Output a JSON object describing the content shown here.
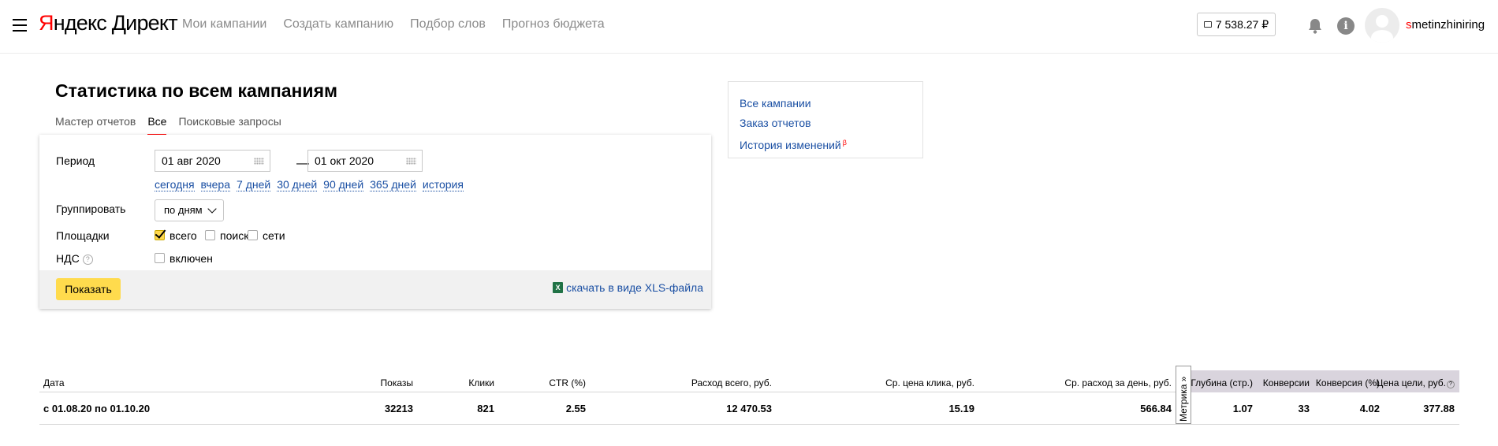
{
  "header": {
    "logo_ya": "Я",
    "logo_rest": "ндекс Директ",
    "nav": [
      "Мои кампании",
      "Создать кампанию",
      "Подбор слов",
      "Прогноз бюджета"
    ],
    "balance": "7 538.27 ₽",
    "username_first": "s",
    "username_rest": "metinzhiniring"
  },
  "page": {
    "title": "Статистика по всем кампаниям",
    "tabs": [
      "Мастер отчетов",
      "Все",
      "Поисковые запросы"
    ]
  },
  "form": {
    "period_label": "Период",
    "date_from": "01 авг 2020",
    "date_to": "01 окт 2020",
    "dash": "—",
    "quick_links": [
      "сегодня",
      "вчера",
      "7 дней",
      "30 дней",
      "90 дней",
      "365 дней",
      "история"
    ],
    "group_label": "Группировать",
    "group_value": "по дням",
    "platforms_label": "Площадки",
    "platforms": [
      "всего",
      "поиск",
      "сети"
    ],
    "vat_label": "НДС",
    "vat_help": "?",
    "vat_option": "включен",
    "show_button": "Показать",
    "xls_link": "скачать в виде XLS-файла",
    "xls_icon": "X"
  },
  "side_links": {
    "all_campaigns": "Все кампании",
    "order_reports": "Заказ отчетов",
    "history": "История изменений",
    "beta": "β"
  },
  "table": {
    "headers": [
      "Дата",
      "Показы",
      "Клики",
      "CTR (%)",
      "Расход всего, руб.",
      "Ср. цена клика, руб.",
      "Ср. расход за день, руб.",
      "Глубина (стр.)",
      "Конверсии",
      "Конверсия (%)",
      "Цена цели, руб."
    ],
    "row": [
      "с 01.08.20 по 01.10.20",
      "32213",
      "821",
      "2.55",
      "12 470.53",
      "15.19",
      "566.84",
      "1.07",
      "33",
      "4.02",
      "377.88"
    ],
    "metrika_tab": "Метрика »",
    "help": "?"
  }
}
